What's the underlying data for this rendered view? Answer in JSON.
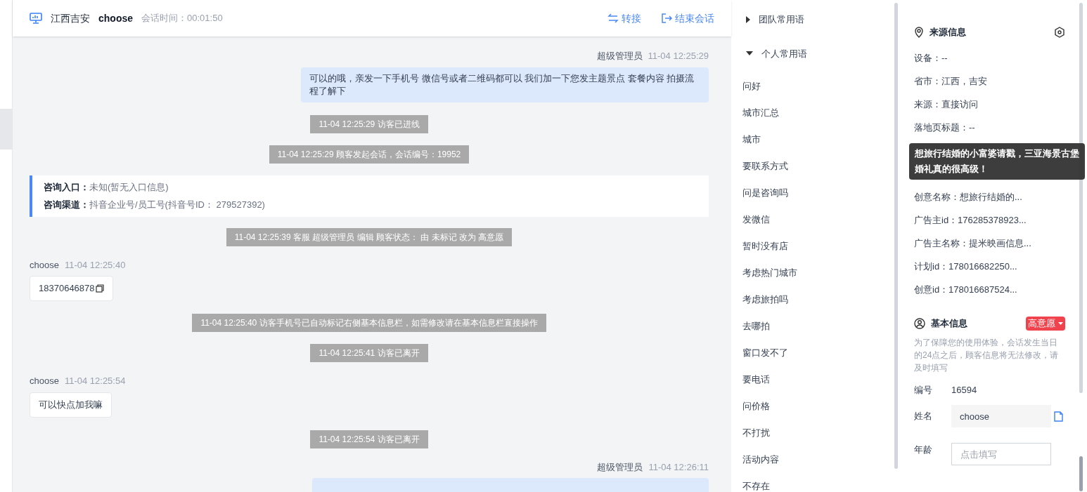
{
  "header": {
    "location": "江西吉安",
    "visitor": "choose",
    "session_time": "会话时间：00:01:50",
    "actions": [
      {
        "kind": "transfer",
        "label": "转接"
      },
      {
        "kind": "end",
        "label": "结束会话"
      }
    ]
  },
  "messages": [
    {
      "kind": "agent",
      "sender": "超级管理员",
      "time": "11-04 12:25:29",
      "text": "可以的哦，亲发一下手机号 微信号或者二维码都可以 我们加一下您发主题景点 套餐内容 拍摄流程了解下"
    },
    {
      "kind": "system",
      "text": "11-04 12:25:29 访客已进线"
    },
    {
      "kind": "system",
      "text": "11-04 12:25:29 顾客发起会话，会话编号：19952"
    },
    {
      "kind": "source",
      "entries": [
        {
          "label": "咨询入口：",
          "value": "未知(暂无入口信息)"
        },
        {
          "label": "咨询渠道：",
          "value": "抖音企业号/员工号(抖音号ID： 279527392)"
        }
      ]
    },
    {
      "kind": "system",
      "text": "11-04 12:25:39 客服 超级管理员 编辑 顾客状态： 由 未标记 改为 高意愿"
    },
    {
      "kind": "visitor",
      "sender": "choose",
      "time": "11-04 12:25:40",
      "text": "18370646878",
      "copyable": true
    },
    {
      "kind": "system",
      "text": "11-04 12:25:40 访客手机号已自动标记右侧基本信息栏，如需修改请在基本信息栏直接操作"
    },
    {
      "kind": "system",
      "text": "11-04 12:25:41 访客已离开"
    },
    {
      "kind": "visitor",
      "sender": "choose",
      "time": "11-04 12:25:54",
      "text": "可以快点加我嘛",
      "copyable": false
    },
    {
      "kind": "system",
      "text": "11-04 12:25:54 访客已离开"
    },
    {
      "kind": "agent",
      "sender": "超级管理员",
      "time": "11-04 12:26:11"
    }
  ],
  "phrases": {
    "groups": [
      {
        "label": "团队常用语",
        "expanded": false
      },
      {
        "label": "个人常用语",
        "expanded": true,
        "items": [
          "问好",
          "城市汇总",
          "城市",
          "要联系方式",
          "问是咨询吗",
          "发微信",
          "暂时没有店",
          "考虑热门城市",
          "考虑旅拍吗",
          "去哪拍",
          "窗口发不了",
          "要电话",
          "问价格",
          "不打扰",
          "活动内容",
          "不存在"
        ]
      }
    ]
  },
  "source_info": {
    "title": "来源信息",
    "rows_before": [
      "设备：--",
      "省市：江西，吉安",
      "来源：直接访问",
      "落地页标题：--"
    ],
    "tooltip": "想旅行结婚的小富婆请戳，三亚海景古堡婚礼真的很高级！",
    "rows_after": [
      "创意名称：想旅行结婚的...",
      "广告主id：176285378923...",
      "广告主名称：提米映画信息...",
      "计划id：178016682250...",
      "创意id：178016687524..."
    ]
  },
  "basic_info": {
    "title": "基本信息",
    "status": "高意愿",
    "notice": "为了保障您的使用体验，会话发生当日的24点之后，顾客信息将无法修改，请及时填写",
    "fields": [
      {
        "kind": "text",
        "label": "编号",
        "value": "16594"
      },
      {
        "kind": "input",
        "label": "姓名",
        "value": "choose"
      },
      {
        "kind": "input",
        "label": "年龄",
        "placeholder": "点击填写"
      }
    ]
  }
}
